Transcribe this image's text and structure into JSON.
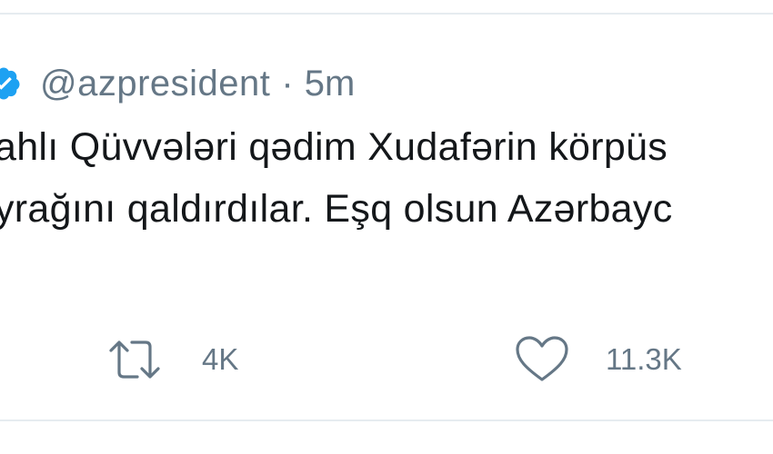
{
  "tweet": {
    "handle": "@azpresident",
    "separator": "·",
    "time": "5m",
    "text_line1": "ahlı Qüvvələri qədim Xudafərin körpüs",
    "text_line2": "yrağını qaldırdılar. Eşq olsun Azərbayc"
  },
  "actions": {
    "retweet_icon": "retweet-icon",
    "retweet_count": "4K",
    "like_icon": "heart-icon",
    "like_count": "11.3K"
  },
  "colors": {
    "verified": "#1da1f2",
    "secondary_text": "#657786",
    "primary_text": "#14171a",
    "divider": "#e6ecf0"
  }
}
